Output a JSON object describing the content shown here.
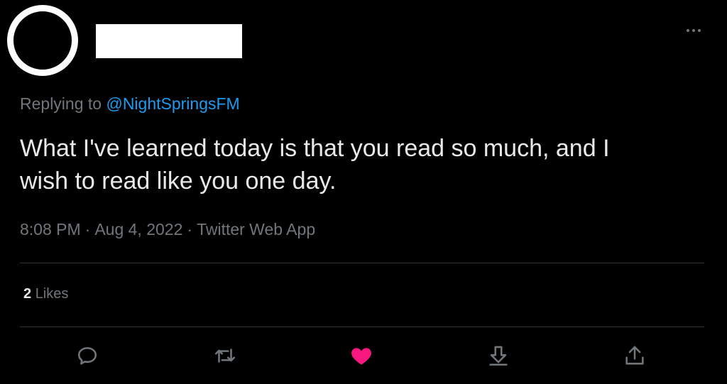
{
  "tweet": {
    "replying_prefix": "Replying to ",
    "replying_to": "@NightSpringsFM",
    "text": "What I've learned today is that you read so much, and I\nwish to read like you one day.",
    "time": "8:08 PM",
    "date": "Aug 4, 2022",
    "separator": "·",
    "source": "Twitter Web App",
    "likes_count": "2",
    "likes_label": "Likes"
  },
  "colors": {
    "background": "#000000",
    "text": "#e7e9ea",
    "muted": "#71767b",
    "link": "#1d9bf0",
    "like_active": "#f91880",
    "divider": "#2f3336"
  },
  "actions": [
    {
      "icon": "reply-icon"
    },
    {
      "icon": "retweet-icon"
    },
    {
      "icon": "heart-icon",
      "active": true
    },
    {
      "icon": "bookmark-icon"
    },
    {
      "icon": "share-icon"
    }
  ]
}
